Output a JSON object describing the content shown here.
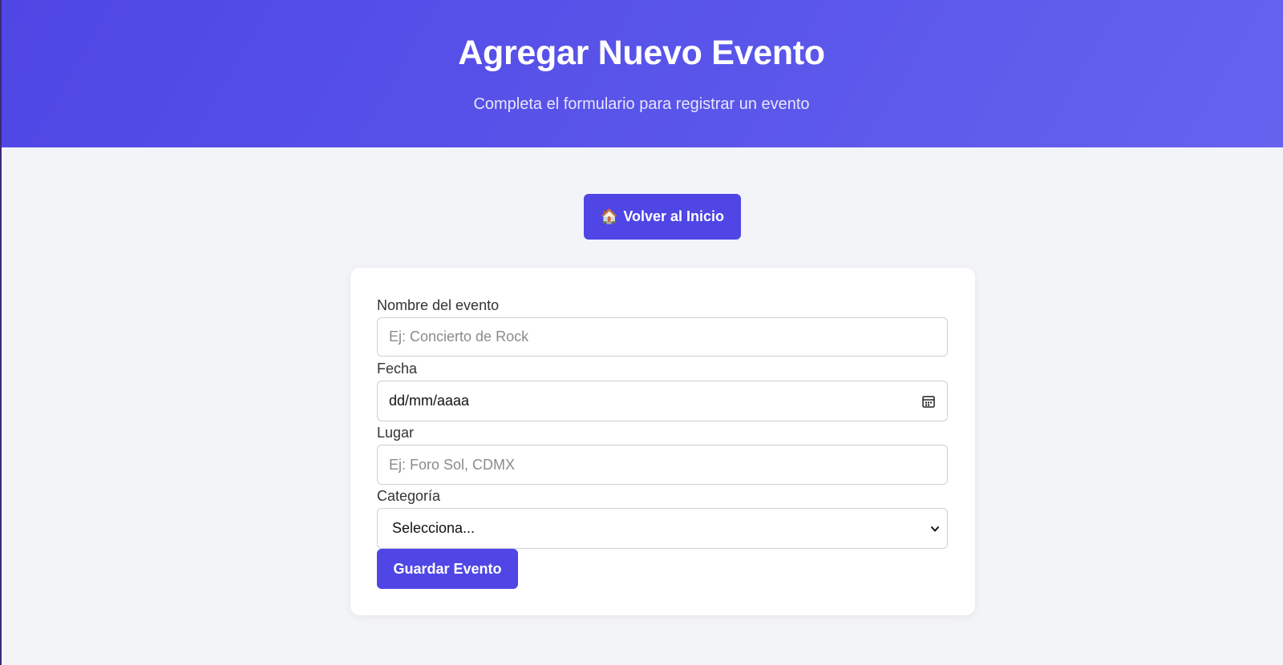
{
  "header": {
    "title": "Agregar Nuevo Evento",
    "subtitle": "Completa el formulario para registrar un evento"
  },
  "nav": {
    "home_button_label": "Volver al Inicio",
    "home_icon": "house-icon"
  },
  "form": {
    "name": {
      "label": "Nombre del evento",
      "placeholder": "Ej: Concierto de Rock",
      "value": ""
    },
    "date": {
      "label": "Fecha",
      "display": "dd/mm/aaaa",
      "icon": "calendar-icon"
    },
    "place": {
      "label": "Lugar",
      "placeholder": "Ej: Foro Sol, CDMX",
      "value": ""
    },
    "category": {
      "label": "Categoría",
      "selected": "Selecciona...",
      "icon": "chevron-down-icon"
    },
    "submit_label": "Guardar Evento"
  },
  "colors": {
    "primary": "#4f46e5",
    "header_gradient_start": "#4f46e5",
    "header_gradient_end": "#6563ee",
    "page_background": "#f3f4f8",
    "card_background": "#ffffff"
  }
}
